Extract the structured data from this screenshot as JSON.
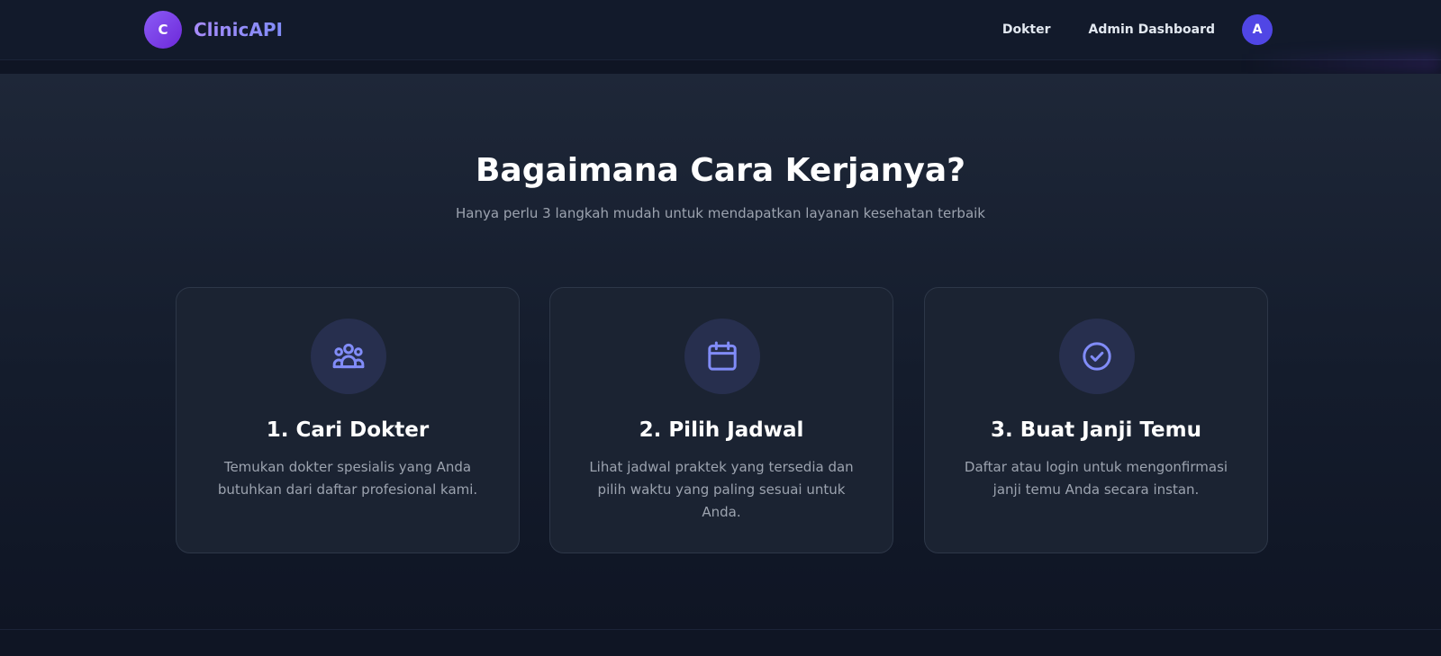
{
  "navbar": {
    "logo_letter": "C",
    "brand": "ClinicAPI",
    "links": [
      "Dokter",
      "Admin Dashboard"
    ],
    "avatar_letter": "A"
  },
  "section": {
    "title": "Bagaimana Cara Kerjanya?",
    "subtitle": "Hanya perlu 3 langkah mudah untuk mendapatkan layanan kesehatan terbaik"
  },
  "steps": [
    {
      "icon": "users-group-icon",
      "title": "1. Cari Dokter",
      "text": "Temukan dokter spesialis yang Anda butuhkan dari daftar profesional kami."
    },
    {
      "icon": "calendar-icon",
      "title": "2. Pilih Jadwal",
      "text": "Lihat jadwal praktek yang tersedia dan pilih waktu yang paling sesuai untuk Anda."
    },
    {
      "icon": "check-circle-icon",
      "title": "3. Buat Janji Temu",
      "text": "Daftar atau login untuk mengonfirmasi janji temu Anda secara instan."
    }
  ],
  "colors": {
    "accent": "#818cf8",
    "brand_purple": "#8b5cf6",
    "avatar": "#5046e5",
    "background": "#0f1524",
    "card": "#1b2332"
  }
}
